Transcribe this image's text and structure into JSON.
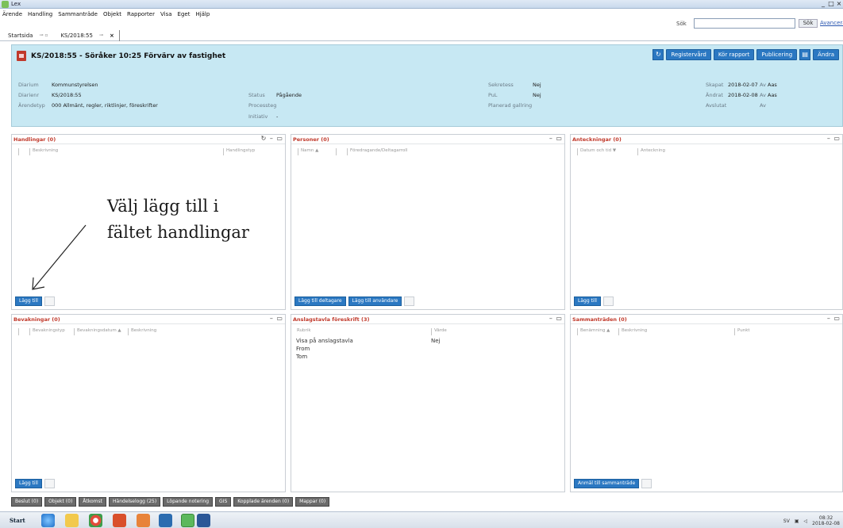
{
  "window": {
    "title": "Lex",
    "controls": [
      "_",
      "□",
      "×"
    ]
  },
  "menu": [
    "Ärende",
    "Handling",
    "Sammanträde",
    "Objekt",
    "Rapporter",
    "Visa",
    "Eget",
    "Hjälp"
  ],
  "search": {
    "label": "Sök",
    "value": "",
    "button": "Sök",
    "advanced": "Avancerad söknin"
  },
  "tabs": [
    {
      "label": "Startsida",
      "pin": "⊸ ▫"
    },
    {
      "label": "KS/2018:55",
      "pin": "⊸",
      "close": "×"
    }
  ],
  "case": {
    "title": "KS/2018:55 - Söråker 10:25 Förvärv av fastighet",
    "actions": [
      "Registervård",
      "Kör rapport",
      "Publicering",
      "Ändra"
    ],
    "fields": {
      "diarium": {
        "label": "Diarium",
        "value": "Kommunstyrelsen"
      },
      "diarienr": {
        "label": "Diarienr",
        "value": "KS/2018:55"
      },
      "arendetyp": {
        "label": "Ärendetyp",
        "value": "000 Allmänt, regler, riktlinjer, föreskrifter"
      },
      "status": {
        "label": "Status",
        "value": "Pågående"
      },
      "processteg": {
        "label": "Processteg",
        "value": ""
      },
      "initiativ": {
        "label": "Initiativ",
        "value": "-"
      },
      "sekretess": {
        "label": "Sekretess",
        "value": "Nej"
      },
      "pul": {
        "label": "PuL",
        "value": "Nej"
      },
      "gallring": {
        "label": "Planerad gallring",
        "value": ""
      },
      "skapat": {
        "label": "Skapat",
        "value": "2018-02-07",
        "av_label": "Av",
        "av": "Aas"
      },
      "andrat": {
        "label": "Ändrat",
        "value": "2018-02-08",
        "av_label": "Av",
        "av": "Aas"
      },
      "avslutat": {
        "label": "Avslutat",
        "value": "",
        "av_label": "Av",
        "av": ""
      }
    }
  },
  "panels": {
    "handlingar": {
      "title": "Handlingar (0)",
      "controls": "↻ – ▭",
      "cols": [
        "Beskrivning",
        "Handlingstyp"
      ],
      "buttons": [
        "Lägg till"
      ]
    },
    "personer": {
      "title": "Personer (0)",
      "controls": "– ▭",
      "cols": [
        "Namn ▲",
        "Föredragande/Deltagarroll"
      ],
      "buttons": [
        "Lägg till deltagare",
        "Lägg till användare"
      ]
    },
    "anteckningar": {
      "title": "Anteckningar (0)",
      "controls": "– ▭",
      "cols": [
        "Datum och tid ▼",
        "Anteckning"
      ],
      "buttons": [
        "Lägg till"
      ]
    },
    "bevakningar": {
      "title": "Bevakningar (0)",
      "controls": "– ▭",
      "cols": [
        "Bevakningstyp",
        "Bevakningsdatum ▲",
        "Beskrivning"
      ],
      "buttons": [
        "Lägg till"
      ]
    },
    "anslagstavla": {
      "title": "Anslagstavla föreskrift (3)",
      "controls": "– ▭",
      "cols": [
        "Rubrik",
        "Värde"
      ],
      "rows": [
        [
          "Visa på anslagstavla",
          "Nej"
        ],
        [
          "From",
          ""
        ],
        [
          "Tom",
          ""
        ]
      ]
    },
    "sammantraden": {
      "title": "Sammanträden (0)",
      "controls": "– ▭",
      "cols": [
        "Benämning ▲",
        "Beskrivning",
        "Punkt"
      ],
      "buttons": [
        "Anmäl till sammanträde"
      ]
    }
  },
  "annotation": {
    "line1": "Välj lägg till i",
    "line2": "fältet handlingar"
  },
  "bottom_tabs": [
    "Beslut (0)",
    "Objekt (0)",
    "Åtkomst",
    "Händelselogg (25)",
    "Löpande notering",
    "GIS",
    "Kopplade ärenden (0)",
    "Mappar (0)"
  ],
  "taskbar": {
    "start": "Start",
    "lang": "SV",
    "time": "08:32",
    "date": "2018-02-08"
  }
}
